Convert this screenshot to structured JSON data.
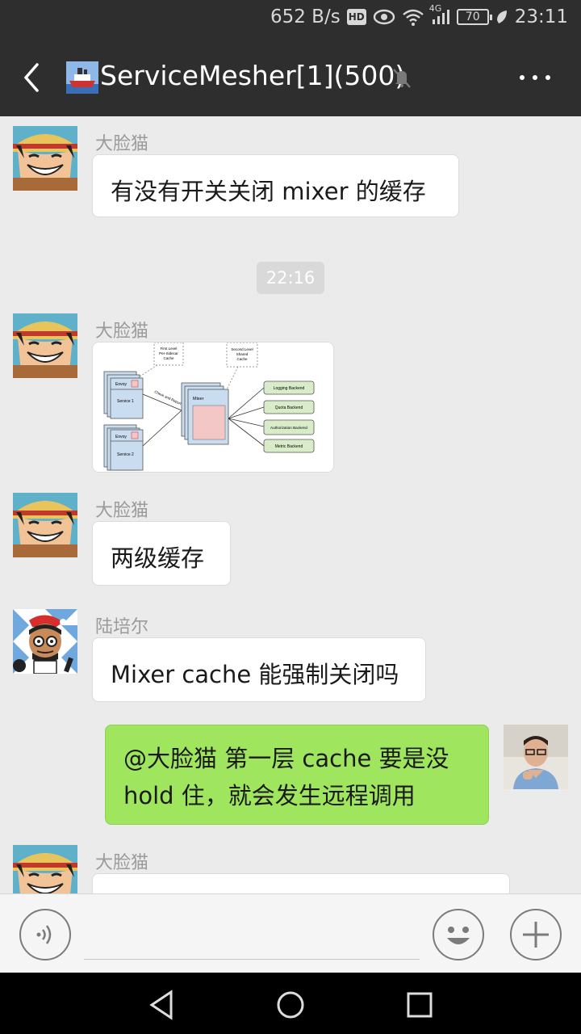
{
  "status_bar": {
    "speed": "652 B/s",
    "hd": "HD",
    "network": "4G",
    "battery": "70",
    "time": "23:11"
  },
  "header": {
    "title": "ServiceMesher[1](500)"
  },
  "messages": [
    {
      "sender": "大脸猫",
      "text": "有没有开关关闭 mixer 的缓存"
    },
    {
      "timestamp": "22:16"
    },
    {
      "sender": "大脸猫",
      "image": {
        "first_level": [
          "First Level",
          "Per-Sidecar",
          "Cache"
        ],
        "second_level": [
          "Second Level",
          "Shared",
          "Cache"
        ],
        "envoy": "Envoy",
        "service_1": "Service 1",
        "service_2": "Service 2",
        "check_report": "Check and Report",
        "mixer": "Mixer",
        "backends": [
          "Logging Backend",
          "Quota Backend",
          "Authorization Backend",
          "Metric Backend"
        ]
      }
    },
    {
      "sender": "大脸猫",
      "text": "两级缓存"
    },
    {
      "sender": "陆培尔",
      "text": "Mixer cache 能强制关闭吗"
    },
    {
      "sender": "self",
      "text": "@大脸猫  第一层 cache 要是没 hold 住，就会发生远程调用"
    },
    {
      "sender": "大脸猫",
      "text": ""
    }
  ],
  "colors": {
    "header_bg": "#2e2e2e",
    "chat_bg": "#ebebeb",
    "self_bubble": "#9fe65e"
  }
}
